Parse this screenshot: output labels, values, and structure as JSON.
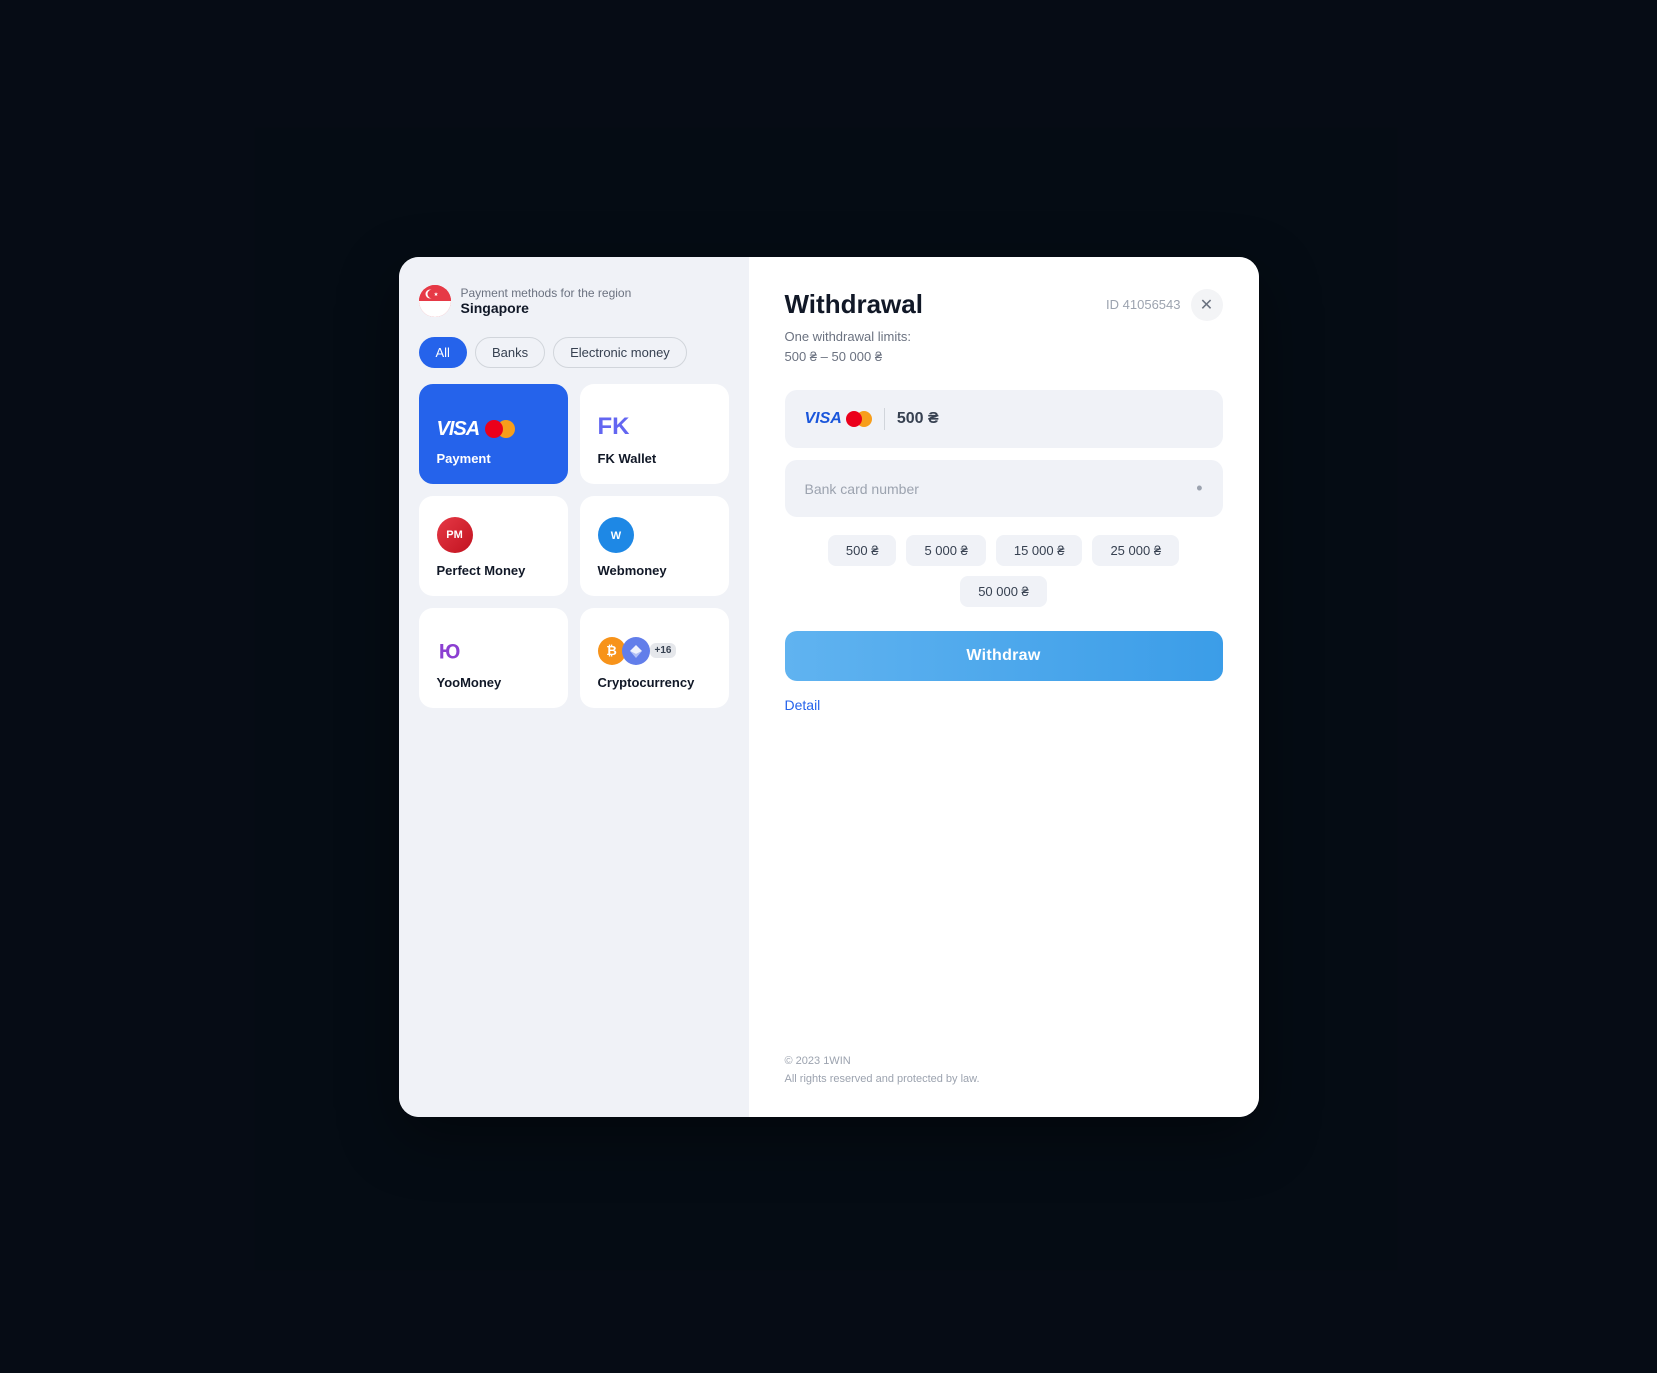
{
  "background": "#0d1b2e",
  "modal": {
    "left": {
      "region_label": "Payment methods for the region",
      "region_name": "Singapore",
      "filters": [
        {
          "id": "all",
          "label": "All",
          "active": true
        },
        {
          "id": "banks",
          "label": "Banks",
          "active": false
        },
        {
          "id": "electronic",
          "label": "Electronic money",
          "active": false
        }
      ],
      "payment_methods": [
        {
          "id": "visa",
          "label": "Payment",
          "selected": true,
          "type": "visa"
        },
        {
          "id": "fk_wallet",
          "label": "FK Wallet",
          "selected": false,
          "type": "fk"
        },
        {
          "id": "perfect_money",
          "label": "Perfect Money",
          "selected": false,
          "type": "pm"
        },
        {
          "id": "webmoney",
          "label": "Webmoney",
          "selected": false,
          "type": "wm"
        },
        {
          "id": "yoomoney",
          "label": "YooMoney",
          "selected": false,
          "type": "yoo"
        },
        {
          "id": "crypto",
          "label": "Cryptocurrency",
          "selected": false,
          "type": "crypto",
          "plus": "+16"
        }
      ]
    },
    "right": {
      "title": "Withdrawal",
      "id_label": "ID 41056543",
      "limits_line1": "One withdrawal limits:",
      "limits_line2": "500 ₴ – 50 000 ₴",
      "amount_currency": "500 ₴",
      "card_placeholder": "Bank card number",
      "quick_amounts": [
        "500 ₴",
        "5 000 ₴",
        "15 000 ₴",
        "25 000 ₴",
        "50 000 ₴"
      ],
      "withdraw_btn": "Withdraw",
      "detail_link": "Detail",
      "footer_line1": "© 2023 1WIN",
      "footer_line2": "All rights reserved and protected by law."
    }
  }
}
